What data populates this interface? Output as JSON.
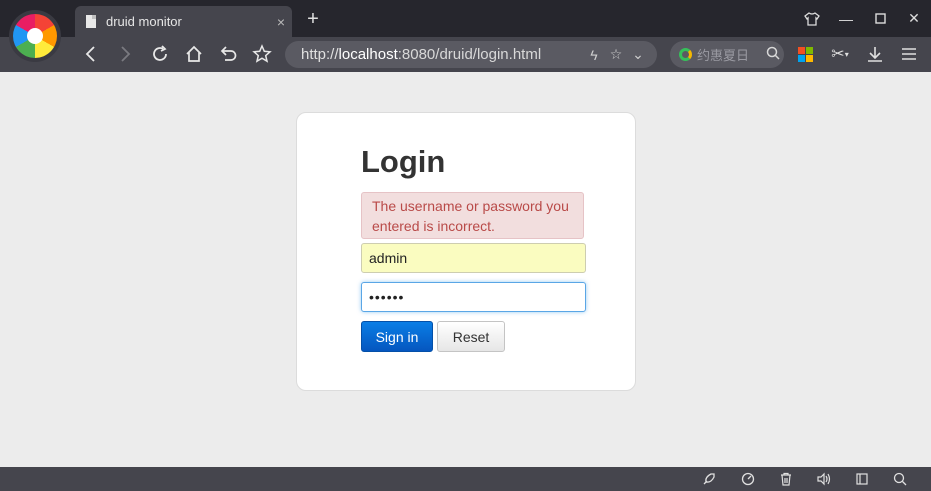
{
  "browser": {
    "tab_title": "druid monitor",
    "tab_close": "×",
    "new_tab": "+",
    "window": {
      "skin": "👕",
      "minimize": "—",
      "maximize": "☐",
      "close": "✕"
    },
    "nav": {
      "back": "‹",
      "forward": "›",
      "reload": "↻",
      "home": "⌂",
      "undo": "↶",
      "favorite": "☆"
    },
    "address": {
      "scheme": "http://",
      "host": "localhost",
      "port_path": ":8080/druid/login.html"
    },
    "address_icons": {
      "lightning": "ϟ",
      "star": "☆",
      "dropdown": "⌄"
    },
    "search": {
      "placeholder": "约惠夏日",
      "icon": "⚲"
    },
    "toolbar_right": {
      "scissors": "✂",
      "download": "⤓",
      "menu": "≡"
    },
    "statusbar": {
      "rocket": "🚀",
      "speed": "◔",
      "trash": "🗑",
      "sound": "🔈",
      "window": "❐",
      "search": "⚲"
    }
  },
  "login": {
    "title": "Login",
    "error": "The username or password you entered is incorrect.",
    "username_value": "admin",
    "password_value": "••••••",
    "signin_label": "Sign in",
    "reset_label": "Reset"
  },
  "colors": {
    "accent": "#0556bf",
    "error_bg": "#f2dede",
    "error_text": "#b94a48",
    "autofill_bg": "#fafcc0"
  }
}
